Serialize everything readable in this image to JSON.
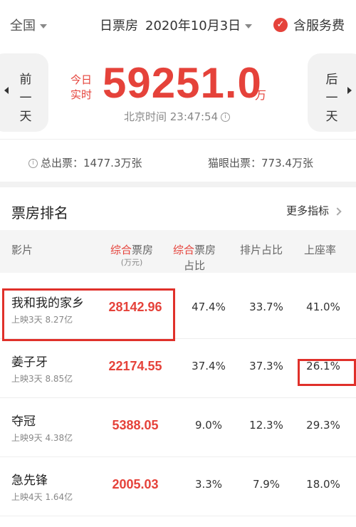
{
  "header": {
    "region": "全国",
    "date_label": "日票房",
    "date": "2020年10月3日",
    "service_fee": "含服务费",
    "check_icon": "check-icon"
  },
  "hero": {
    "prev_label": [
      "前",
      "一",
      "天"
    ],
    "next_label": [
      "后",
      "一",
      "天"
    ],
    "today_label": [
      "今日",
      "实时"
    ],
    "total_box_office": "59251.0",
    "unit": "万",
    "beijing_time": "北京时间 23:47:54"
  },
  "totals": {
    "total_tickets": "总出票：1477.3万张",
    "maoyan_tickets": "猫眼出票：773.4万张"
  },
  "ranking": {
    "title": "票房排名",
    "more": "更多指标",
    "headers": {
      "film": "影片",
      "box_office_red": "综合",
      "box_office_rest": "票房",
      "box_office_unit": "(万元)",
      "share_red": "综合",
      "share_rest": "票房",
      "share_line2": "占比",
      "screening": "排片占比",
      "occupancy": "上座率"
    },
    "rows": [
      {
        "name": "我和我的家乡",
        "info": "上映3天  8.27亿",
        "box_office": "28142.96",
        "share": "47.4%",
        "screening": "33.7%",
        "occupancy": "41.0%"
      },
      {
        "name": "姜子牙",
        "info": "上映3天  8.85亿",
        "box_office": "22174.55",
        "share": "37.4%",
        "screening": "37.3%",
        "occupancy": "26.1%"
      },
      {
        "name": "夺冠",
        "info": "上映9天  4.38亿",
        "box_office": "5388.05",
        "share": "9.0%",
        "screening": "12.3%",
        "occupancy": "29.3%"
      },
      {
        "name": "急先锋",
        "info": "上映4天  1.64亿",
        "box_office": "2005.03",
        "share": "3.3%",
        "screening": "7.9%",
        "occupancy": "18.0%"
      }
    ]
  },
  "colors": {
    "accent": "#e5423a",
    "highlight_box": "#e0302a"
  }
}
